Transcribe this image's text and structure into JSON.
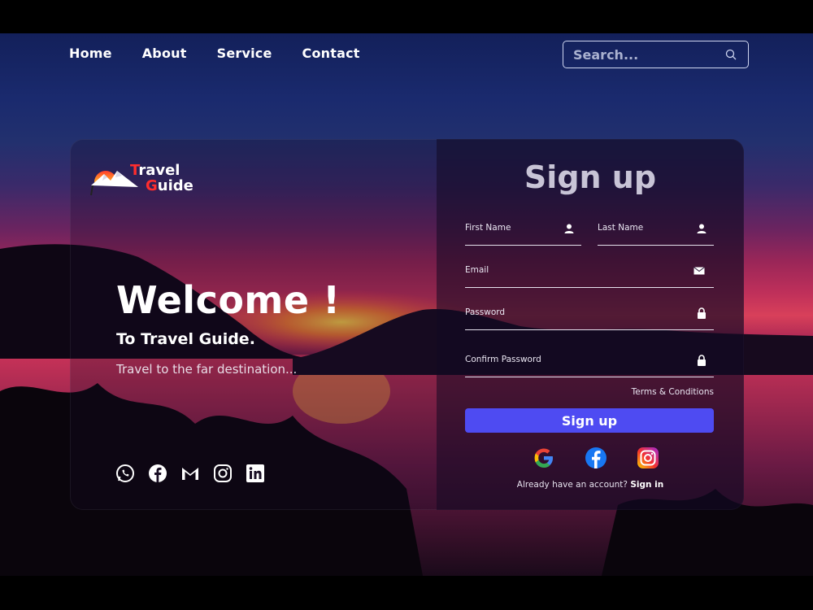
{
  "nav": {
    "items": [
      "Home",
      "About",
      "Service",
      "Contact"
    ]
  },
  "search": {
    "placeholder": "Search..."
  },
  "logo": {
    "line1_cap": "T",
    "line1_rest": "ravel",
    "line2_cap": "G",
    "line2_rest": "uide"
  },
  "hero": {
    "title": "Welcome !",
    "subtitle": "To Travel Guide.",
    "tagline": "Travel to the far destination..."
  },
  "socials": [
    "whatsapp-icon",
    "facebook-icon",
    "gmail-icon",
    "instagram-icon",
    "linkedin-icon"
  ],
  "form": {
    "title": "Sign up",
    "first_name": "First Name",
    "last_name": "Last Name",
    "email": "Email",
    "password": "Password",
    "confirm_password": "Confirm Password",
    "terms": "Terms & Conditions",
    "submit": "Sign up",
    "already": "Already have an account?",
    "signin": "Sign in"
  },
  "colors": {
    "accent": "#4e4bf2",
    "logo_red": "#ff2d2d"
  }
}
